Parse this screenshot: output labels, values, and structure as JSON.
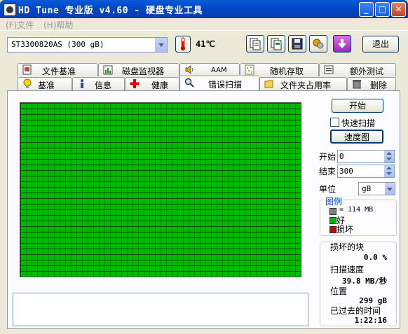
{
  "window": {
    "title": "HD Tune 专业版 v4.60 - 硬盘专业工具",
    "minimize": "_",
    "maximize": "□",
    "close": "✕"
  },
  "menu": {
    "file": "(F)文件",
    "help": "(H)帮助"
  },
  "toolbar": {
    "drive": "ST3300820AS (300 gB)",
    "temperature": "41℃",
    "exit_label": "退出",
    "icons": [
      "copy-icon",
      "copy-all-icon",
      "save-icon",
      "options-icon",
      "download-icon"
    ]
  },
  "tabs_row1": [
    {
      "label": "文件基准",
      "icon": "file-benchmark-icon"
    },
    {
      "label": "磁盘监视器",
      "icon": "disk-monitor-icon"
    },
    {
      "label": "AAM",
      "icon": "speaker-icon"
    },
    {
      "label": "随机存取",
      "icon": "random-access-icon"
    },
    {
      "label": "额外测试",
      "icon": "extra-tests-icon"
    }
  ],
  "tabs_row2": [
    {
      "label": "基准",
      "icon": "bulb-icon"
    },
    {
      "label": "信息",
      "icon": "info-icon"
    },
    {
      "label": "健康",
      "icon": "health-cross-icon"
    },
    {
      "label": "错误扫描",
      "icon": "magnifier-icon",
      "active": true
    },
    {
      "label": "文件夹占用率",
      "icon": "folder-icon"
    },
    {
      "label": "删除",
      "icon": "trash-icon"
    }
  ],
  "controls": {
    "start_button": "开始",
    "quick_scan_label": "快速扫描",
    "quick_scan_checked": false,
    "speed_map_button": "速度图",
    "start_label": "开始",
    "start_value": "0",
    "end_label": "结束",
    "end_value": "300",
    "unit_label": "单位",
    "unit_value": "gB"
  },
  "legend": {
    "title": "图例",
    "block_size": "= 114 MB",
    "good": "好",
    "bad": "损坏",
    "colors": {
      "block": "#808080",
      "good": "#00b800",
      "bad": "#d00000"
    }
  },
  "stats": {
    "bad_blocks_label": "损坏的块",
    "bad_blocks_value": "0.0 %",
    "scan_speed_label": "扫描速度",
    "scan_speed_value": "39.8 MB/秒",
    "position_label": "位置",
    "position_value": "299 gB",
    "elapsed_label": "已过去的时间",
    "elapsed_value": "1:22:16"
  },
  "scan_map": {
    "status": "all blocks good",
    "good_color": "#00b800",
    "progress_percent": 100
  }
}
